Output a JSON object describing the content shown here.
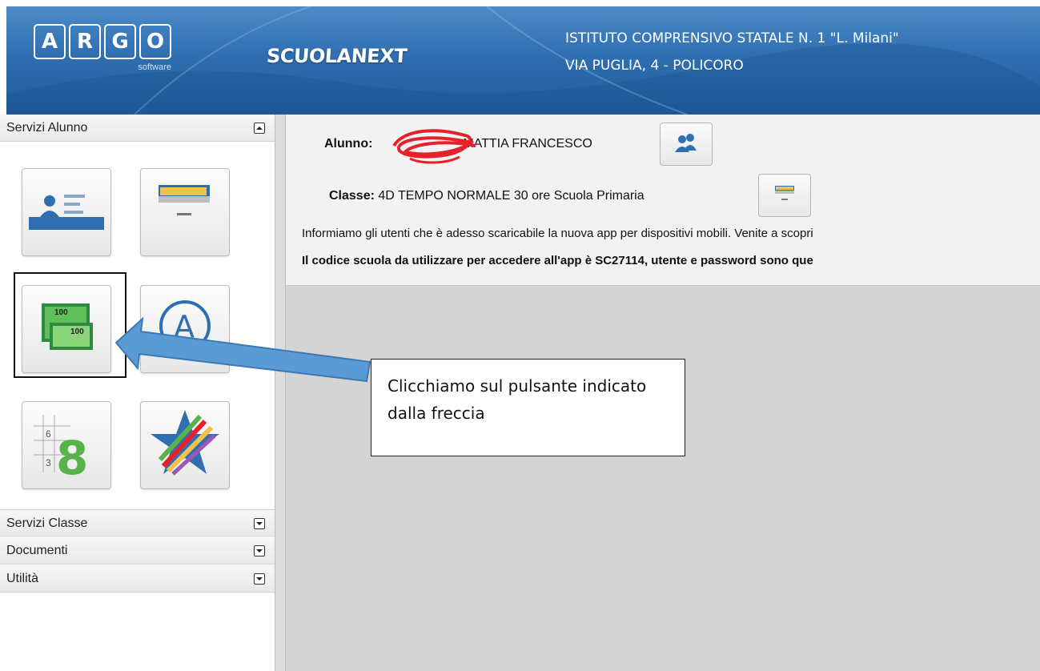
{
  "header": {
    "logo_letters": [
      "A",
      "R",
      "G",
      "O"
    ],
    "logo_sub": "software",
    "brand": "SCUOLANEXT",
    "school_name": "ISTITUTO COMPRENSIVO STATALE N. 1 \"L. Milani\"",
    "school_address": "VIA PUGLIA, 4 - POLICORO"
  },
  "sidebar": {
    "panels": [
      {
        "label": "Servizi Alunno",
        "state": "expanded"
      },
      {
        "label": "Servizi Classe",
        "state": "collapsed"
      },
      {
        "label": "Documenti",
        "state": "collapsed"
      },
      {
        "label": "Utilità",
        "state": "collapsed"
      }
    ],
    "tiles": [
      {
        "icon": "student-card-icon"
      },
      {
        "icon": "archive-drawer-icon"
      },
      {
        "icon": "money-banknotes-icon",
        "highlighted": true
      },
      {
        "icon": "circle-a-icon"
      },
      {
        "icon": "calendar-grades-icon"
      },
      {
        "icon": "colorful-star-icon"
      }
    ]
  },
  "main": {
    "student_label": "Alunno:",
    "student_name": "MATTIA FRANCESCO",
    "class_label": "Classe:",
    "class_value": "4D TEMPO NORMALE 30 ore Scuola Primaria",
    "message_line1": "Informiamo gli utenti che è adesso scaricabile la nuova app per dispositivi mobili. Venite a scopri",
    "message_line2": "Il codice scuola da utilizzare per accedere all'app è SC27114, utente e password sono que"
  },
  "annotation": {
    "callout_text": "Clicchiamo sul pulsante indicato dalla freccia"
  },
  "colors": {
    "header_blue": "#2f6fb1",
    "arrow_blue": "#5b9bd5",
    "scribble_red": "#e8202a"
  }
}
